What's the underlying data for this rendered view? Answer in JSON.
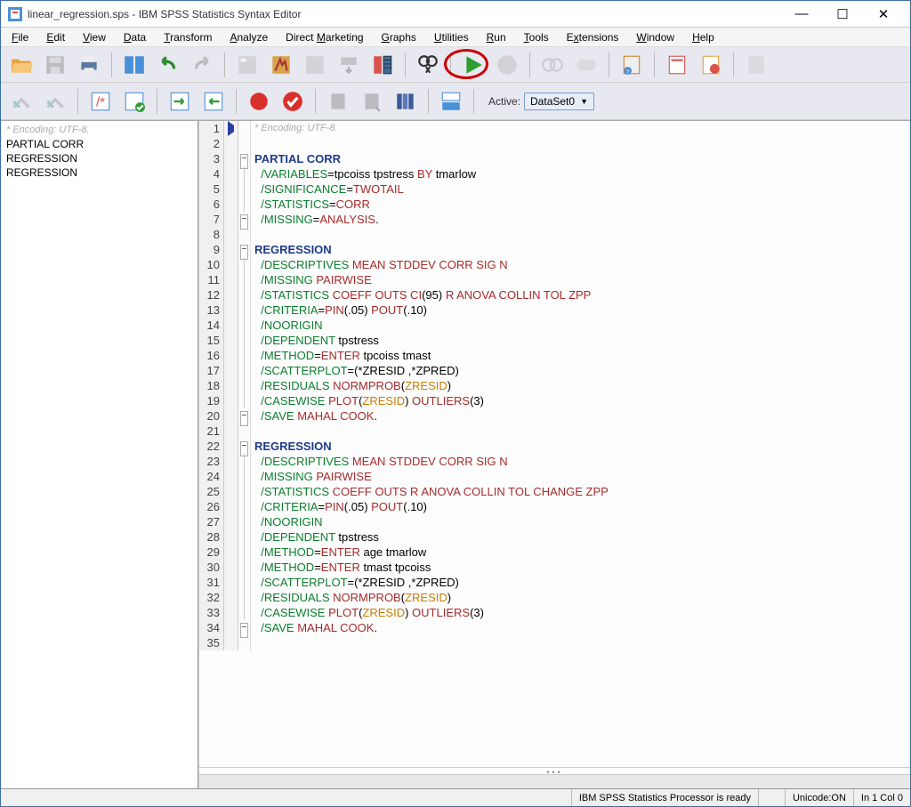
{
  "window": {
    "title": "linear_regression.sps - IBM SPSS Statistics Syntax Editor"
  },
  "menu": [
    "File",
    "Edit",
    "View",
    "Data",
    "Transform",
    "Analyze",
    "Direct Marketing",
    "Graphs",
    "Utilities",
    "Run",
    "Tools",
    "Extensions",
    "Window",
    "Help"
  ],
  "menu_underline_idx": [
    0,
    0,
    0,
    0,
    0,
    0,
    7,
    0,
    0,
    0,
    0,
    1,
    0,
    0
  ],
  "active_label": "Active:",
  "active_dataset": "DataSet0",
  "nav": {
    "encoding": "* Encoding: UTF-8.",
    "items": [
      "PARTIAL CORR",
      "REGRESSION",
      "REGRESSION"
    ]
  },
  "editor": {
    "encoding": "* Encoding: UTF-8.",
    "line_count": 35,
    "lines": [
      {
        "n": 1,
        "type": "encoding"
      },
      {
        "n": 2,
        "html": ""
      },
      {
        "n": 3,
        "html": "<span class='cmd'>PARTIAL CORR</span>"
      },
      {
        "n": 4,
        "html": "  <span class='sub'>/VARIABLES</span>=<span class='var'>tpcoiss tpstress</span> <span class='kw'>BY</span> <span class='var'>tmarlow</span>"
      },
      {
        "n": 5,
        "html": "  <span class='sub'>/SIGNIFICANCE</span>=<span class='kw'>TWOTAIL</span>"
      },
      {
        "n": 6,
        "html": "  <span class='sub'>/STATISTICS</span>=<span class='kw'>CORR</span>"
      },
      {
        "n": 7,
        "html": "  <span class='sub'>/MISSING</span>=<span class='kw'>ANALYSIS</span>."
      },
      {
        "n": 8,
        "html": ""
      },
      {
        "n": 9,
        "html": "<span class='cmd'>REGRESSION</span>"
      },
      {
        "n": 10,
        "html": "  <span class='sub'>/DESCRIPTIVES</span> <span class='kw'>MEAN STDDEV CORR SIG N</span>"
      },
      {
        "n": 11,
        "html": "  <span class='sub'>/MISSING</span> <span class='kw'>PAIRWISE</span>"
      },
      {
        "n": 12,
        "html": "  <span class='sub'>/STATISTICS</span> <span class='kw'>COEFF OUTS CI</span>(<span class='num'>95</span>) <span class='kw'>R ANOVA COLLIN TOL ZPP</span>"
      },
      {
        "n": 13,
        "html": "  <span class='sub'>/CRITERIA</span>=<span class='kw'>PIN</span>(.05) <span class='kw'>POUT</span>(.10)"
      },
      {
        "n": 14,
        "html": "  <span class='sub'>/NOORIGIN</span>"
      },
      {
        "n": 15,
        "html": "  <span class='sub'>/DEPENDENT</span> <span class='var'>tpstress</span>"
      },
      {
        "n": 16,
        "html": "  <span class='sub'>/METHOD</span>=<span class='kw'>ENTER</span> <span class='var'>tpcoiss tmast</span>"
      },
      {
        "n": 17,
        "html": "  <span class='sub'>/SCATTERPLOT</span>=(*ZRESID ,*ZPRED)"
      },
      {
        "n": 18,
        "html": "  <span class='sub'>/RESIDUALS</span> <span class='kw'>NORMPROB</span>(<span class='ident'>ZRESID</span>)"
      },
      {
        "n": 19,
        "html": "  <span class='sub'>/CASEWISE</span> <span class='kw'>PLOT</span>(<span class='ident'>ZRESID</span>) <span class='kw'>OUTLIERS</span>(<span class='num'>3</span>)"
      },
      {
        "n": 20,
        "html": "  <span class='sub'>/SAVE</span> <span class='kw'>MAHAL COOK</span>."
      },
      {
        "n": 21,
        "html": ""
      },
      {
        "n": 22,
        "html": "<span class='cmd'>REGRESSION</span>"
      },
      {
        "n": 23,
        "html": "  <span class='sub'>/DESCRIPTIVES</span> <span class='kw'>MEAN STDDEV CORR SIG N</span>"
      },
      {
        "n": 24,
        "html": "  <span class='sub'>/MISSING</span> <span class='kw'>PAIRWISE</span>"
      },
      {
        "n": 25,
        "html": "  <span class='sub'>/STATISTICS</span> <span class='kw'>COEFF OUTS R ANOVA COLLIN TOL CHANGE ZPP</span>"
      },
      {
        "n": 26,
        "html": "  <span class='sub'>/CRITERIA</span>=<span class='kw'>PIN</span>(.05) <span class='kw'>POUT</span>(.10)"
      },
      {
        "n": 27,
        "html": "  <span class='sub'>/NOORIGIN</span>"
      },
      {
        "n": 28,
        "html": "  <span class='sub'>/DEPENDENT</span> <span class='var'>tpstress</span>"
      },
      {
        "n": 29,
        "html": "  <span class='sub'>/METHOD</span>=<span class='kw'>ENTER</span> <span class='var'>age tmarlow</span>"
      },
      {
        "n": 30,
        "html": "  <span class='sub'>/METHOD</span>=<span class='kw'>ENTER</span> <span class='var'>tmast tpcoiss</span>"
      },
      {
        "n": 31,
        "html": "  <span class='sub'>/SCATTERPLOT</span>=(*ZRESID ,*ZPRED)"
      },
      {
        "n": 32,
        "html": "  <span class='sub'>/RESIDUALS</span> <span class='kw'>NORMPROB</span>(<span class='ident'>ZRESID</span>)"
      },
      {
        "n": 33,
        "html": "  <span class='sub'>/CASEWISE</span> <span class='kw'>PLOT</span>(<span class='ident'>ZRESID</span>) <span class='kw'>OUTLIERS</span>(<span class='num'>3</span>)"
      },
      {
        "n": 34,
        "html": "  <span class='sub'>/SAVE</span> <span class='kw'>MAHAL COOK</span>."
      },
      {
        "n": 35,
        "html": ""
      }
    ],
    "fold_starts": [
      3,
      9,
      22
    ],
    "fold_ends": [
      7,
      20,
      34
    ],
    "cursor_line": 1
  },
  "status": {
    "processor": "IBM SPSS Statistics Processor is ready",
    "unicode": "Unicode:ON",
    "position": "In 1 Col 0"
  }
}
